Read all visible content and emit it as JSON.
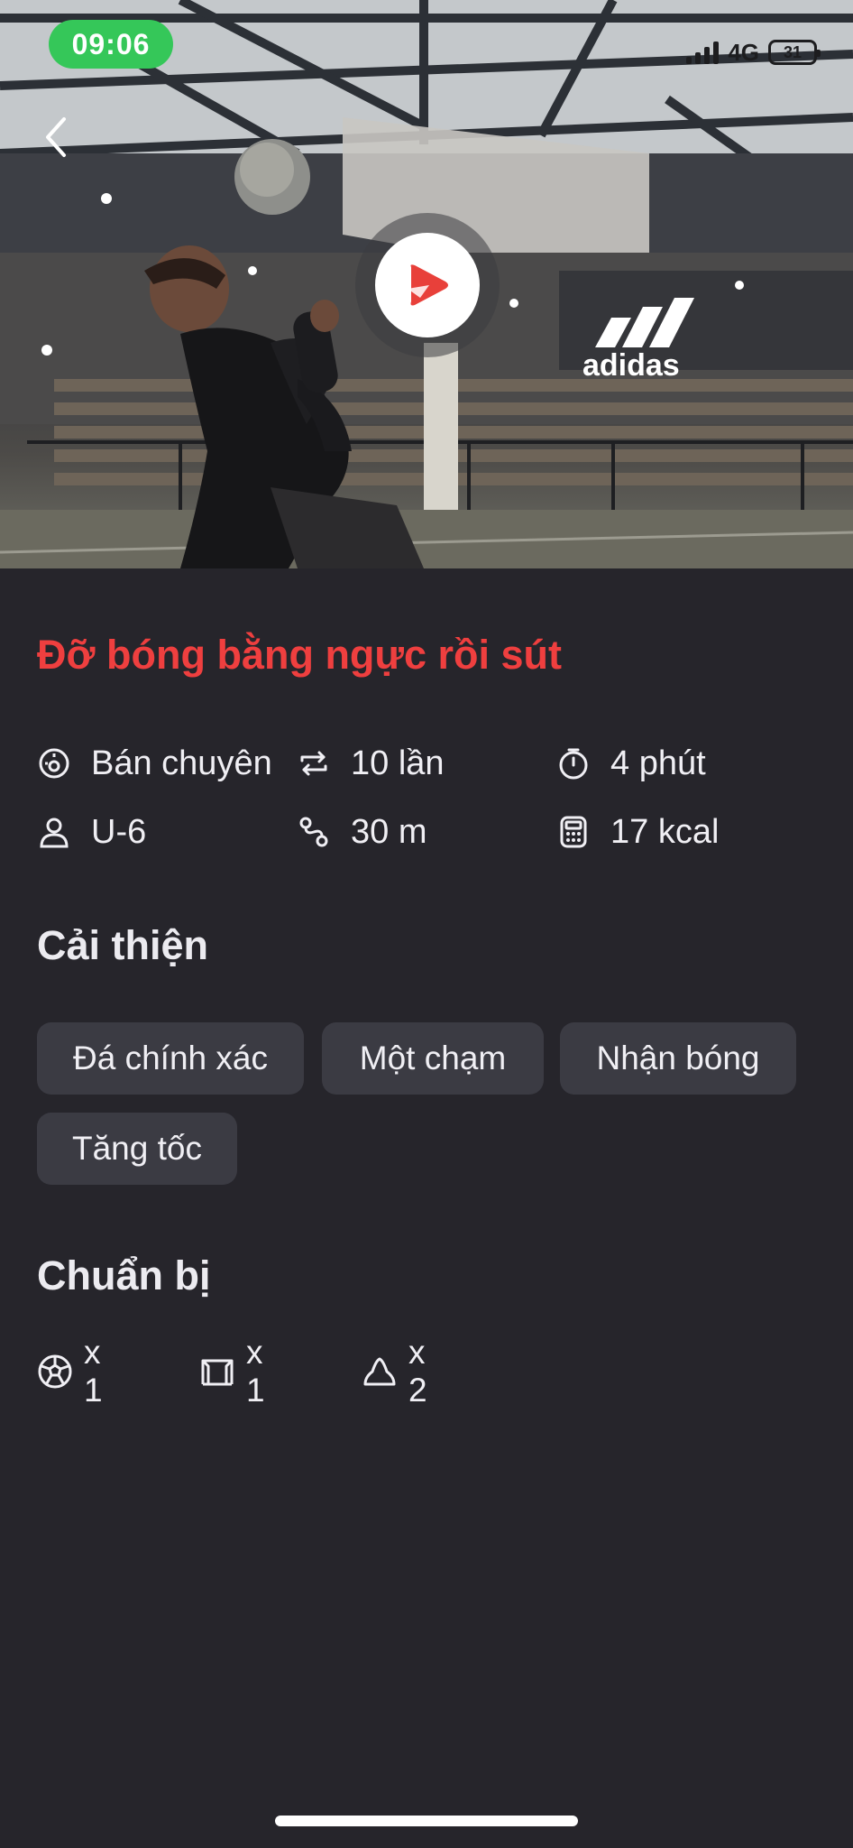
{
  "status_bar": {
    "time": "09:06",
    "network": "4G",
    "battery": "31"
  },
  "hero": {
    "brand_text": "adidas"
  },
  "drill": {
    "title": "Đỡ bóng bằng ngực rồi sút"
  },
  "stats": [
    {
      "icon": "skill-level-icon",
      "value": "Bán chuyên"
    },
    {
      "icon": "repeat-icon",
      "value": "10 lần"
    },
    {
      "icon": "timer-icon",
      "value": "4 phút"
    },
    {
      "icon": "person-icon",
      "value": "U-6"
    },
    {
      "icon": "route-distance-icon",
      "value": "30 m"
    },
    {
      "icon": "calculator-icon",
      "value": "17 kcal"
    }
  ],
  "improve": {
    "title": "Cải thiện",
    "chips": [
      "Đá chính xác",
      "Một chạm",
      "Nhận bóng",
      "Tăng tốc"
    ]
  },
  "prepare": {
    "title": "Chuẩn bị",
    "items": [
      {
        "icon": "soccer-ball-icon",
        "count": "x 1"
      },
      {
        "icon": "goal-icon",
        "count": "x 1"
      },
      {
        "icon": "cone-icon",
        "count": "x 2"
      }
    ]
  },
  "colors": {
    "accent": "#ef3f3f",
    "status_pill": "#35c759",
    "background": "#26252b",
    "chip": "#3b3b43"
  }
}
